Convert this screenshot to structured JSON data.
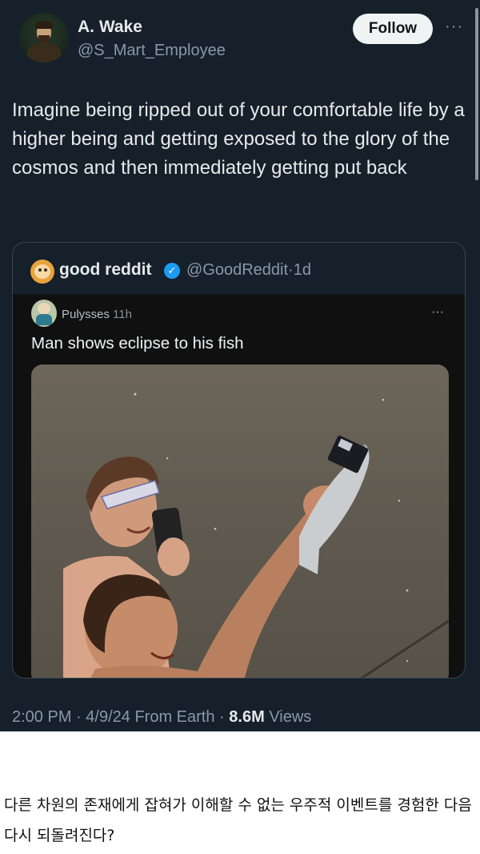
{
  "tweet": {
    "author": {
      "display_name": "A. Wake",
      "handle": "@S_Mart_Employee"
    },
    "follow_label": "Follow",
    "more_icon": "more-horizontal-icon",
    "text": "Imagine being ripped out of your comfortable life by a higher being and getting exposed to the glory of the cosmos and then immediately getting put back",
    "quote": {
      "name": "good reddit",
      "verified_icon": "verified-badge-icon",
      "handle": "@GoodReddit",
      "separator": "·",
      "age": "1d",
      "reddit_post": {
        "user": "Pulysses",
        "time": "11h",
        "more_icon": "more-horizontal-icon",
        "title": "Man shows eclipse to his fish"
      }
    },
    "meta": {
      "time": "2:00 PM",
      "date": "4/9/24",
      "source": "From Earth",
      "views_count": "8.6M",
      "views_label": "Views",
      "separator": "·"
    }
  },
  "caption": "다른 차원의 존재에게 잡혀가 이해할 수 없는 우주적 이벤트를 경험한 다음 다시 되돌려진다?",
  "colors": {
    "background": "#15202b",
    "text": "#e7e9ea",
    "muted": "#8b98a5",
    "verified": "#1d9bf0",
    "follow_bg": "#eff3f4"
  }
}
